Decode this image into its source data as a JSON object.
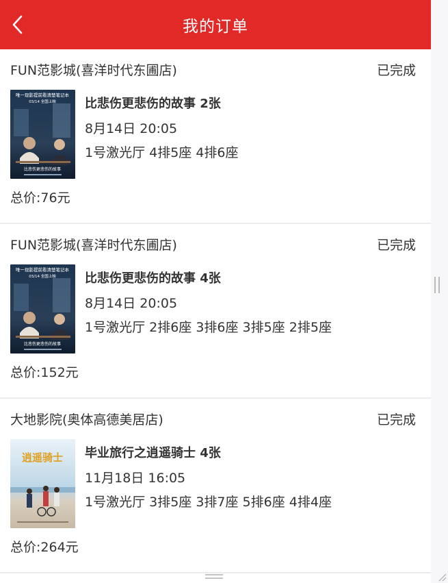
{
  "header": {
    "title": "我的订单",
    "back_icon": "chevron-left-icon"
  },
  "colors": {
    "header_bg": "#e12a28",
    "text": "#333333",
    "divider": "#ececec"
  },
  "orders": [
    {
      "cinema": "FUN范影城(喜洋时代东圃店)",
      "status": "已完成",
      "movie": "比悲伤更悲伤的故事  2张",
      "time": "8月14日  20:05",
      "hall_seats": "1号激光厅  4排5座  4排6座",
      "total": "总价:76元",
      "poster": {
        "top_line": "唯一现影提前看清楚笔记本",
        "date_line": "03/14 全国上映",
        "title": "比悲伤更悲伤的故事"
      }
    },
    {
      "cinema": "FUN范影城(喜洋时代东圃店)",
      "status": "已完成",
      "movie": "比悲伤更悲伤的故事  4张",
      "time": "8月14日  20:05",
      "hall_seats": "1号激光厅  2排6座  3排6座  3排5座  2排5座",
      "total": "总价:152元",
      "poster": {
        "top_line": "唯一现影提前看清楚笔记本",
        "date_line": "03/14 全国上映",
        "title": "比悲伤更悲伤的故事"
      }
    },
    {
      "cinema": "大地影院(奥体高德美居店)",
      "status": "已完成",
      "movie": "毕业旅行之逍遥骑士  4张",
      "time": "11月18日  16:05",
      "hall_seats": "1号激光厅  3排5座  3排7座  5排6座  4排4座",
      "total": "总价:264元",
      "poster": {
        "title": "逍遥骑士"
      }
    }
  ]
}
